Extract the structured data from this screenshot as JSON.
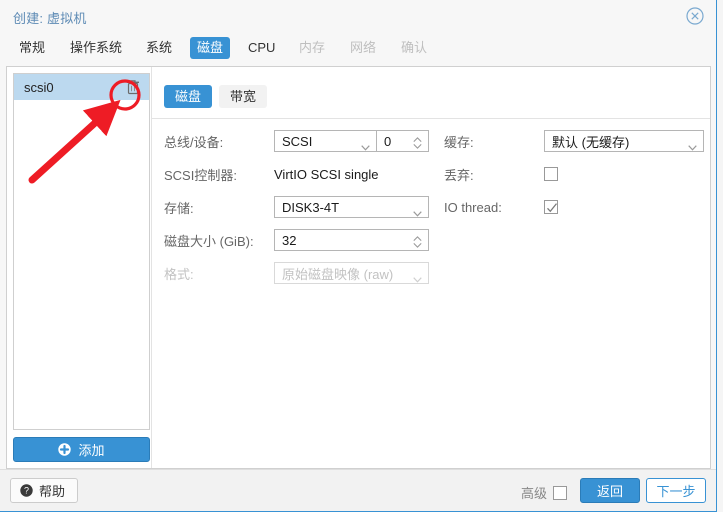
{
  "window": {
    "title": "创建: 虚拟机",
    "close_icon": "close-circle-icon"
  },
  "tabs": [
    {
      "label": "常规",
      "state": "enabled"
    },
    {
      "label": "操作系统",
      "state": "enabled"
    },
    {
      "label": "系统",
      "state": "enabled"
    },
    {
      "label": "磁盘",
      "state": "active"
    },
    {
      "label": "CPU",
      "state": "enabled"
    },
    {
      "label": "内存",
      "state": "disabled"
    },
    {
      "label": "网络",
      "state": "disabled"
    },
    {
      "label": "确认",
      "state": "disabled"
    }
  ],
  "device_list": {
    "items": [
      {
        "label": "scsi0",
        "selected": true,
        "delete_icon": "trash-icon"
      }
    ],
    "add_button": {
      "label": "添加",
      "icon": "plus-circle-icon"
    }
  },
  "subtabs": [
    {
      "label": "磁盘",
      "state": "active"
    },
    {
      "label": "带宽",
      "state": "enabled"
    }
  ],
  "form": {
    "left": {
      "bus_device": {
        "label": "总线/设备:",
        "bus_value": "SCSI",
        "device_index": "0"
      },
      "scsi_controller": {
        "label": "SCSI控制器:",
        "value": "VirtIO SCSI single"
      },
      "storage": {
        "label": "存储:",
        "value": "DISK3-4T"
      },
      "disk_size": {
        "label": "磁盘大小 (GiB):",
        "value": "32"
      },
      "format": {
        "label": "格式:",
        "value": "原始磁盘映像 (raw)",
        "disabled": true
      }
    },
    "right": {
      "cache": {
        "label": "缓存:",
        "value": "默认 (无缓存)"
      },
      "discard": {
        "label": "丢弃:",
        "checked": false
      },
      "io_thread": {
        "label": "IO thread:",
        "checked": true
      }
    }
  },
  "footer": {
    "help": {
      "label": "帮助",
      "icon": "question-circle-icon"
    },
    "advanced": {
      "label": "高级",
      "checked": false
    },
    "back": "返回",
    "next": "下一步"
  },
  "annotation": {
    "highlight_color": "#ee1c25",
    "target": "trash-icon"
  },
  "colors": {
    "accent": "#3892d4",
    "title_text": "#5e8bb5",
    "selected_row": "#bcd9ef",
    "annotation_red": "#ee1c25"
  }
}
